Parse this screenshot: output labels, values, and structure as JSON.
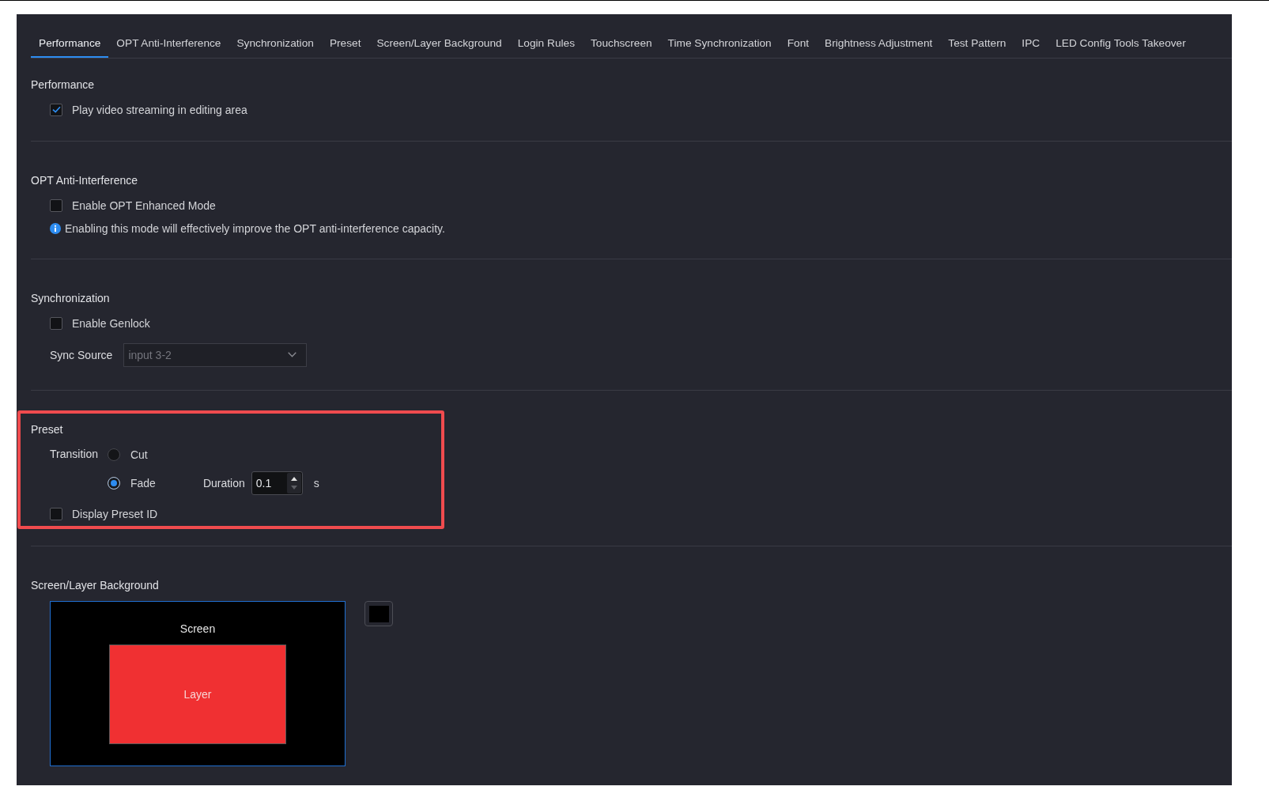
{
  "tabs": [
    {
      "label": "Performance",
      "selected": true
    },
    {
      "label": "OPT Anti-Interference",
      "selected": false
    },
    {
      "label": "Synchronization",
      "selected": false
    },
    {
      "label": "Preset",
      "selected": false
    },
    {
      "label": "Screen/Layer Background",
      "selected": false
    },
    {
      "label": "Login Rules",
      "selected": false
    },
    {
      "label": "Touchscreen",
      "selected": false
    },
    {
      "label": "Time Synchronization",
      "selected": false
    },
    {
      "label": "Font",
      "selected": false
    },
    {
      "label": "Brightness Adjustment",
      "selected": false
    },
    {
      "label": "Test Pattern",
      "selected": false
    },
    {
      "label": "IPC",
      "selected": false
    },
    {
      "label": "LED Config Tools Takeover",
      "selected": false
    }
  ],
  "sections": [
    {
      "title": "Performance",
      "highlighted": false,
      "items": [
        {
          "kind": "checkbox",
          "label": "Play video streaming in editing area",
          "checked": true
        }
      ]
    },
    {
      "title": "OPT Anti-Interference",
      "highlighted": false,
      "items": [
        {
          "kind": "checkbox",
          "label": "Enable OPT Enhanced Mode",
          "checked": false
        },
        {
          "kind": "info",
          "text": "Enabling this mode will effectively improve the OPT anti-interference capacity."
        }
      ]
    },
    {
      "title": "Synchronization",
      "highlighted": false,
      "items": [
        {
          "kind": "checkbox",
          "label": "Enable Genlock",
          "checked": false
        },
        {
          "kind": "select",
          "label": "Sync Source",
          "value": "input 3-2",
          "disabled": true
        }
      ]
    },
    {
      "title": "Preset",
      "highlighted": true,
      "items": [
        {
          "kind": "radio_group",
          "label": "Transition",
          "options": [
            {
              "label": "Cut",
              "selected": false
            },
            {
              "label": "Fade",
              "selected": true,
              "duration": {
                "label": "Duration",
                "value": "0.1",
                "unit": "s"
              }
            }
          ]
        },
        {
          "kind": "checkbox",
          "label": "Display Preset ID",
          "checked": false
        }
      ]
    },
    {
      "title": "Screen/Layer Background",
      "highlighted": false,
      "items": [
        {
          "kind": "background_preview",
          "screen_label": "Screen",
          "layer_label": "Layer"
        }
      ]
    }
  ]
}
